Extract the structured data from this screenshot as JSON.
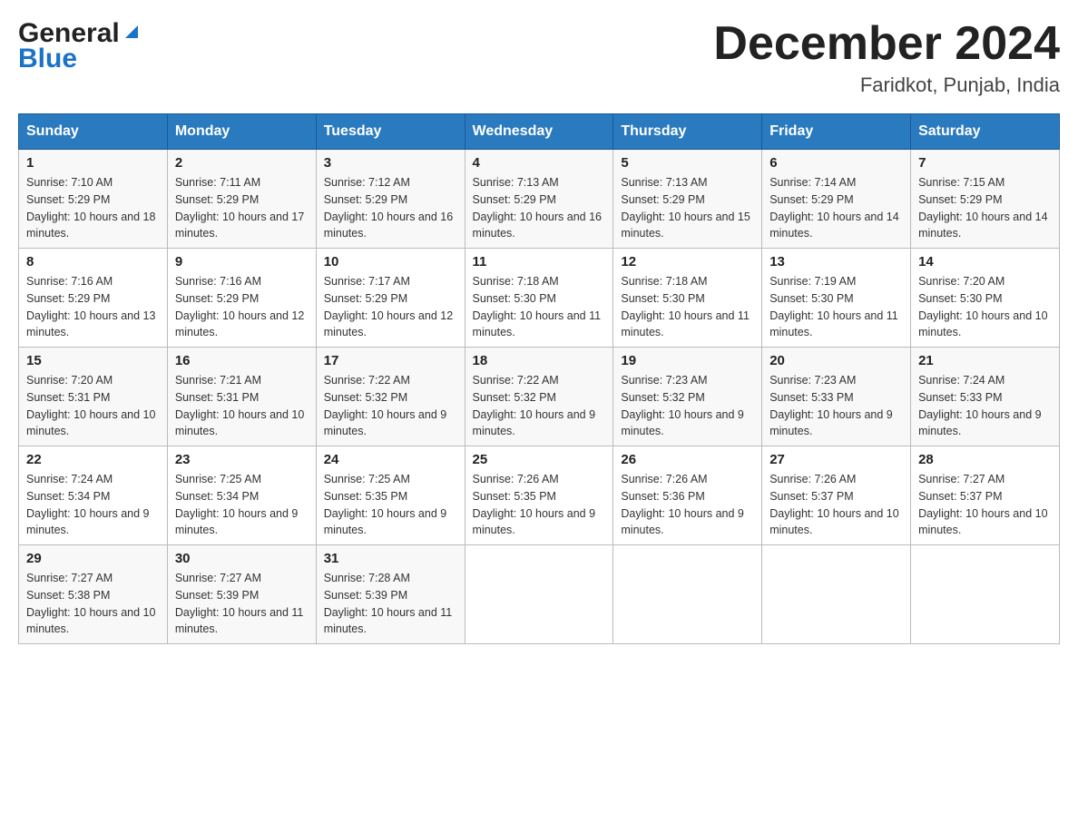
{
  "header": {
    "logo_general": "General",
    "logo_blue": "Blue",
    "month_title": "December 2024",
    "location": "Faridkot, Punjab, India"
  },
  "weekdays": [
    "Sunday",
    "Monday",
    "Tuesday",
    "Wednesday",
    "Thursday",
    "Friday",
    "Saturday"
  ],
  "weeks": [
    [
      {
        "day": "1",
        "sunrise": "Sunrise: 7:10 AM",
        "sunset": "Sunset: 5:29 PM",
        "daylight": "Daylight: 10 hours and 18 minutes."
      },
      {
        "day": "2",
        "sunrise": "Sunrise: 7:11 AM",
        "sunset": "Sunset: 5:29 PM",
        "daylight": "Daylight: 10 hours and 17 minutes."
      },
      {
        "day": "3",
        "sunrise": "Sunrise: 7:12 AM",
        "sunset": "Sunset: 5:29 PM",
        "daylight": "Daylight: 10 hours and 16 minutes."
      },
      {
        "day": "4",
        "sunrise": "Sunrise: 7:13 AM",
        "sunset": "Sunset: 5:29 PM",
        "daylight": "Daylight: 10 hours and 16 minutes."
      },
      {
        "day": "5",
        "sunrise": "Sunrise: 7:13 AM",
        "sunset": "Sunset: 5:29 PM",
        "daylight": "Daylight: 10 hours and 15 minutes."
      },
      {
        "day": "6",
        "sunrise": "Sunrise: 7:14 AM",
        "sunset": "Sunset: 5:29 PM",
        "daylight": "Daylight: 10 hours and 14 minutes."
      },
      {
        "day": "7",
        "sunrise": "Sunrise: 7:15 AM",
        "sunset": "Sunset: 5:29 PM",
        "daylight": "Daylight: 10 hours and 14 minutes."
      }
    ],
    [
      {
        "day": "8",
        "sunrise": "Sunrise: 7:16 AM",
        "sunset": "Sunset: 5:29 PM",
        "daylight": "Daylight: 10 hours and 13 minutes."
      },
      {
        "day": "9",
        "sunrise": "Sunrise: 7:16 AM",
        "sunset": "Sunset: 5:29 PM",
        "daylight": "Daylight: 10 hours and 12 minutes."
      },
      {
        "day": "10",
        "sunrise": "Sunrise: 7:17 AM",
        "sunset": "Sunset: 5:29 PM",
        "daylight": "Daylight: 10 hours and 12 minutes."
      },
      {
        "day": "11",
        "sunrise": "Sunrise: 7:18 AM",
        "sunset": "Sunset: 5:30 PM",
        "daylight": "Daylight: 10 hours and 11 minutes."
      },
      {
        "day": "12",
        "sunrise": "Sunrise: 7:18 AM",
        "sunset": "Sunset: 5:30 PM",
        "daylight": "Daylight: 10 hours and 11 minutes."
      },
      {
        "day": "13",
        "sunrise": "Sunrise: 7:19 AM",
        "sunset": "Sunset: 5:30 PM",
        "daylight": "Daylight: 10 hours and 11 minutes."
      },
      {
        "day": "14",
        "sunrise": "Sunrise: 7:20 AM",
        "sunset": "Sunset: 5:30 PM",
        "daylight": "Daylight: 10 hours and 10 minutes."
      }
    ],
    [
      {
        "day": "15",
        "sunrise": "Sunrise: 7:20 AM",
        "sunset": "Sunset: 5:31 PM",
        "daylight": "Daylight: 10 hours and 10 minutes."
      },
      {
        "day": "16",
        "sunrise": "Sunrise: 7:21 AM",
        "sunset": "Sunset: 5:31 PM",
        "daylight": "Daylight: 10 hours and 10 minutes."
      },
      {
        "day": "17",
        "sunrise": "Sunrise: 7:22 AM",
        "sunset": "Sunset: 5:32 PM",
        "daylight": "Daylight: 10 hours and 9 minutes."
      },
      {
        "day": "18",
        "sunrise": "Sunrise: 7:22 AM",
        "sunset": "Sunset: 5:32 PM",
        "daylight": "Daylight: 10 hours and 9 minutes."
      },
      {
        "day": "19",
        "sunrise": "Sunrise: 7:23 AM",
        "sunset": "Sunset: 5:32 PM",
        "daylight": "Daylight: 10 hours and 9 minutes."
      },
      {
        "day": "20",
        "sunrise": "Sunrise: 7:23 AM",
        "sunset": "Sunset: 5:33 PM",
        "daylight": "Daylight: 10 hours and 9 minutes."
      },
      {
        "day": "21",
        "sunrise": "Sunrise: 7:24 AM",
        "sunset": "Sunset: 5:33 PM",
        "daylight": "Daylight: 10 hours and 9 minutes."
      }
    ],
    [
      {
        "day": "22",
        "sunrise": "Sunrise: 7:24 AM",
        "sunset": "Sunset: 5:34 PM",
        "daylight": "Daylight: 10 hours and 9 minutes."
      },
      {
        "day": "23",
        "sunrise": "Sunrise: 7:25 AM",
        "sunset": "Sunset: 5:34 PM",
        "daylight": "Daylight: 10 hours and 9 minutes."
      },
      {
        "day": "24",
        "sunrise": "Sunrise: 7:25 AM",
        "sunset": "Sunset: 5:35 PM",
        "daylight": "Daylight: 10 hours and 9 minutes."
      },
      {
        "day": "25",
        "sunrise": "Sunrise: 7:26 AM",
        "sunset": "Sunset: 5:35 PM",
        "daylight": "Daylight: 10 hours and 9 minutes."
      },
      {
        "day": "26",
        "sunrise": "Sunrise: 7:26 AM",
        "sunset": "Sunset: 5:36 PM",
        "daylight": "Daylight: 10 hours and 9 minutes."
      },
      {
        "day": "27",
        "sunrise": "Sunrise: 7:26 AM",
        "sunset": "Sunset: 5:37 PM",
        "daylight": "Daylight: 10 hours and 10 minutes."
      },
      {
        "day": "28",
        "sunrise": "Sunrise: 7:27 AM",
        "sunset": "Sunset: 5:37 PM",
        "daylight": "Daylight: 10 hours and 10 minutes."
      }
    ],
    [
      {
        "day": "29",
        "sunrise": "Sunrise: 7:27 AM",
        "sunset": "Sunset: 5:38 PM",
        "daylight": "Daylight: 10 hours and 10 minutes."
      },
      {
        "day": "30",
        "sunrise": "Sunrise: 7:27 AM",
        "sunset": "Sunset: 5:39 PM",
        "daylight": "Daylight: 10 hours and 11 minutes."
      },
      {
        "day": "31",
        "sunrise": "Sunrise: 7:28 AM",
        "sunset": "Sunset: 5:39 PM",
        "daylight": "Daylight: 10 hours and 11 minutes."
      },
      {
        "day": "",
        "sunrise": "",
        "sunset": "",
        "daylight": ""
      },
      {
        "day": "",
        "sunrise": "",
        "sunset": "",
        "daylight": ""
      },
      {
        "day": "",
        "sunrise": "",
        "sunset": "",
        "daylight": ""
      },
      {
        "day": "",
        "sunrise": "",
        "sunset": "",
        "daylight": ""
      }
    ]
  ]
}
